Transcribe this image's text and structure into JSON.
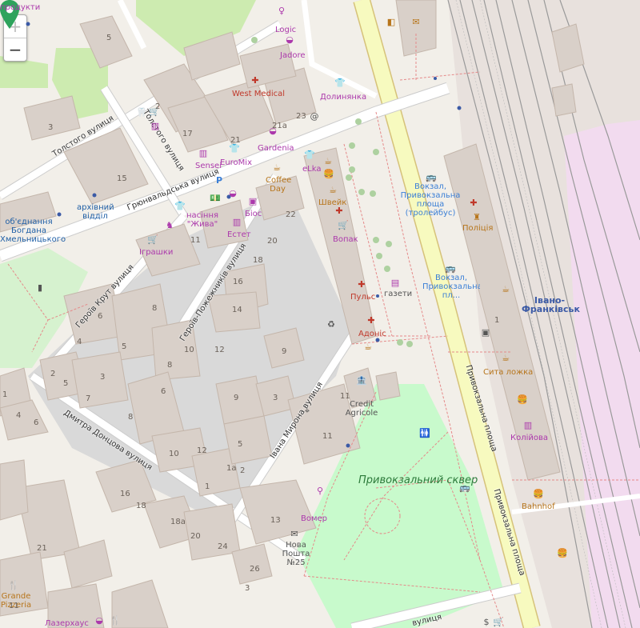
{
  "controls": {
    "zoom_in": "+",
    "zoom_out": "−"
  },
  "streets": {
    "tolstoho1": "Толстого вулиця",
    "tolstoho2": "Толстого вулиця",
    "hrunvaldska": "Грюнвальдська вулиця",
    "heroiv_krut": "Героїв Крут вулиця",
    "heroiv_pozhezhnykiv": "Героїв-Пожежників вулиця",
    "donczova": "Дмитра Донцова вулиця",
    "myrona": "Івана Мирона вулиця",
    "pryvokz1": "Привокзальна площа",
    "pryvokz2": "Привокзальна площа",
    "bottom": "вулиця"
  },
  "places": {
    "logic": "Logic",
    "jadore": "Jadore",
    "west_medical": "West Medical",
    "dolynianka": "Долинянка",
    "sensei": "Sensei",
    "euromix": "EuroMix",
    "gardenia": "Gardenia",
    "elka": "eLka",
    "coffee_day": "Coffee Day",
    "shveik": "Швейк",
    "vopak": "Вопак",
    "puls": "Пульс",
    "hazety": "газети",
    "adonis": "Адоніс",
    "credit_agricole": "Credit Agricole",
    "vomer": "Вомер",
    "nova_poshta": "Нова Пошта №25",
    "bahnhof": "Bahnhof",
    "kolyiova": "Колійова",
    "syta_lozhka": "Сита ложка",
    "politsiia": "Поліція",
    "vokzal_troll": "Вокзал, Привокзальна площа (тролейбус)",
    "vokzal_bus": "Вокзал, Привокзальна пл...",
    "ivano_frankivsk": "Івано-Франківськ",
    "nasinnia_zhyva": "насіння \"Жива\"",
    "bios": "Біос",
    "estet": "Естет",
    "ihrashky": "Іграшки",
    "arkhivnyi": "архівний відділ",
    "obiednannia": "об'єднання Богдана Хмельницького",
    "grande_pizzeria": "Grande Pizzeria",
    "lazerhaus": "Лазерхаус",
    "privokz_skver": "Привокзальний сквер",
    "produkty": "продукти"
  },
  "house_numbers": [
    "5",
    "2",
    "3",
    "17",
    "21",
    "21а",
    "23",
    "15",
    "11",
    "22",
    "20",
    "18",
    "16",
    "14",
    "8",
    "6",
    "4",
    "5",
    "10",
    "12",
    "9",
    "8",
    "6",
    "2",
    "3",
    "5",
    "7",
    "1",
    "4",
    "6",
    "8",
    "10",
    "12",
    "9",
    "3",
    "5",
    "2",
    "1а",
    "1",
    "11",
    "11",
    "13",
    "16",
    "18",
    "18а",
    "20",
    "24",
    "26",
    "3",
    "21",
    "11",
    "1"
  ],
  "colors": {
    "road_primary": "#f7fabf",
    "road_primary_border": "#d6c27a",
    "landuse_gray": "#d9d9d9",
    "park": "#c8facc",
    "railway": "#bbbbbb",
    "building": "#d9d0c9",
    "poi_purple": "#ac39ac",
    "poi_red": "#c0392b",
    "poi_brown": "#b7751b",
    "marker": "#2ea35c"
  }
}
